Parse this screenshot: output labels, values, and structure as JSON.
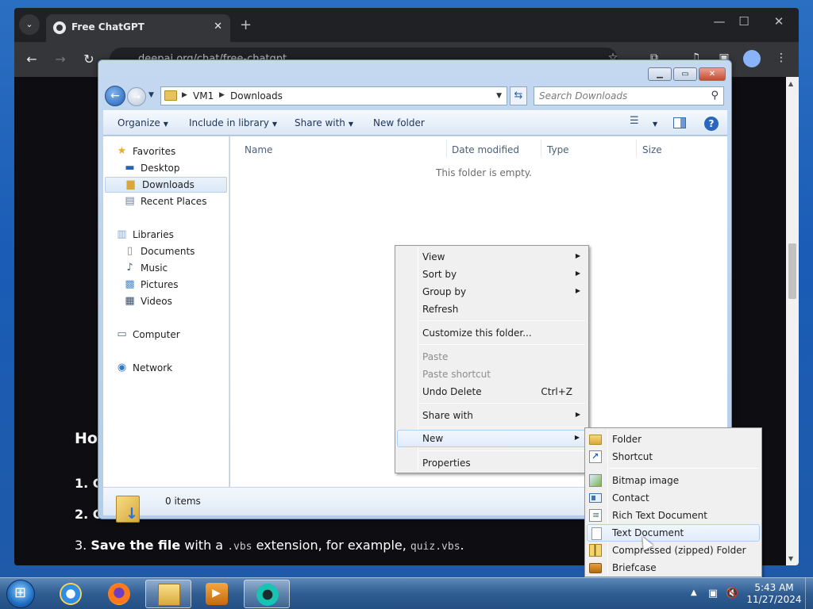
{
  "browser": {
    "tab_title": "Free ChatGPT",
    "url_partial": "deepai.org/chat/free-chatgpt",
    "page": {
      "heading_partial": "How",
      "steps": [
        {
          "num": "1. C"
        },
        {
          "num": "2. C"
        },
        {
          "num": "3.",
          "bold": "Save the file",
          "text1": " with a ",
          "code1": ".vbs",
          "text2": " extension, for example, ",
          "code2": "quiz.vbs",
          "end": "."
        }
      ]
    }
  },
  "explorer": {
    "breadcrumb": [
      "VM1",
      "Downloads"
    ],
    "search_placeholder": "Search Downloads",
    "toolbar": {
      "organize": "Organize",
      "include_in_library": "Include in library",
      "share_with": "Share with",
      "new_folder": "New folder"
    },
    "columns": [
      "Name",
      "Date modified",
      "Type",
      "Size"
    ],
    "empty_message": "This folder is empty.",
    "status_items": "0 items",
    "nav": {
      "favorites": "Favorites",
      "desktop": "Desktop",
      "downloads": "Downloads",
      "recent_places": "Recent Places",
      "libraries": "Libraries",
      "documents": "Documents",
      "music": "Music",
      "pictures": "Pictures",
      "videos": "Videos",
      "computer": "Computer",
      "network": "Network"
    }
  },
  "context_menu": {
    "view": "View",
    "sort_by": "Sort by",
    "group_by": "Group by",
    "refresh": "Refresh",
    "customize": "Customize this folder...",
    "paste": "Paste",
    "paste_shortcut": "Paste shortcut",
    "undo_delete": "Undo Delete",
    "undo_shortcut": "Ctrl+Z",
    "share_with": "Share with",
    "new": "New",
    "properties": "Properties"
  },
  "new_submenu": {
    "folder": "Folder",
    "shortcut": "Shortcut",
    "bitmap": "Bitmap image",
    "contact": "Contact",
    "rtf": "Rich Text Document",
    "txt": "Text Document",
    "zip": "Compressed (zipped) Folder",
    "briefcase": "Briefcase"
  },
  "taskbar": {
    "time": "5:43 AM",
    "date": "11/27/2024"
  }
}
